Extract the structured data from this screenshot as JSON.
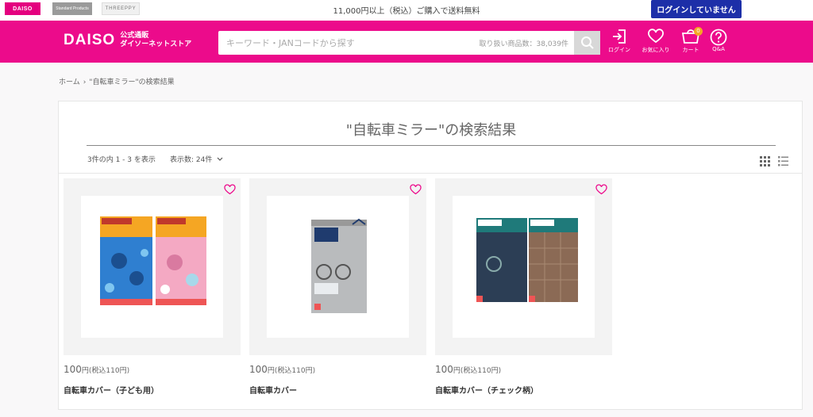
{
  "topbar": {
    "brands": [
      "DAISO",
      "Standard Products",
      "THREEPPY"
    ],
    "free_shipping": "11,000円以上（税込）ご購入で送料無料",
    "login_status": "ログインしていません"
  },
  "header": {
    "logo_mark": "DAISO",
    "logo_sub1": "公式通販",
    "logo_sub2": "ダイソーネットストア",
    "search_placeholder": "キーワード・JANコードから探す",
    "search_count": "取り扱い商品数：38,039件",
    "icons": [
      {
        "label": "ログイン",
        "icon": "login-icon"
      },
      {
        "label": "お気に入り",
        "icon": "heart-icon"
      },
      {
        "label": "カート",
        "icon": "cart-icon",
        "badge": "0"
      },
      {
        "label": "Q&A",
        "icon": "question-icon"
      }
    ]
  },
  "breadcrumb": {
    "home": "ホーム",
    "separator": "›",
    "current": "\"自転車ミラー\"の検索結果"
  },
  "results": {
    "title": "\"自転車ミラー\"の検索結果",
    "info": "3件の内 1 - 3 を表示",
    "per_page": "表示数: 24件"
  },
  "products": [
    {
      "price": "100",
      "price_unit": "円(税込110円)",
      "name": "自転車カバー（子ども用）"
    },
    {
      "price": "100",
      "price_unit": "円(税込110円)",
      "name": "自転車カバー"
    },
    {
      "price": "100",
      "price_unit": "円(税込110円)",
      "name": "自転車カバー（チェック柄）"
    }
  ],
  "colors": {
    "brand_pink": "#ec0b8b",
    "login_blue": "#1d2fa8",
    "badge_orange": "#f5a623"
  }
}
